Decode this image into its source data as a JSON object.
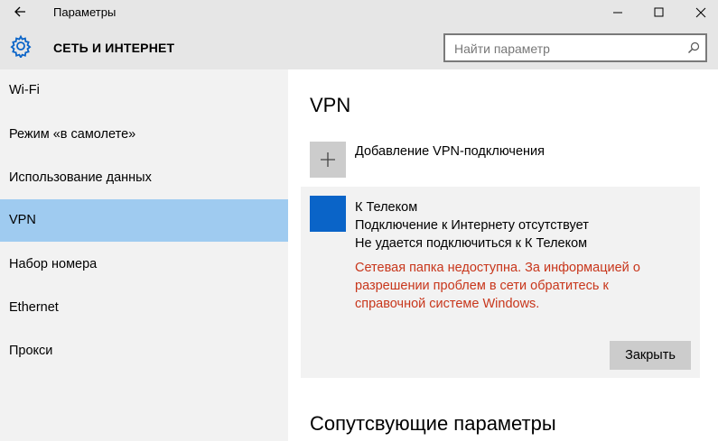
{
  "window": {
    "title": "Параметры",
    "controls": [
      "minimize-icon",
      "maximize-icon",
      "close-icon"
    ]
  },
  "header": {
    "icon": "gear-icon",
    "section_title": "СЕТЬ И ИНТЕРНЕТ",
    "search_placeholder": "Найти параметр"
  },
  "sidebar": {
    "items": [
      {
        "label": "Wi-Fi",
        "active": false
      },
      {
        "label": "Режим «в самолете»",
        "active": false
      },
      {
        "label": "Использование данных",
        "active": false
      },
      {
        "label": "VPN",
        "active": true
      },
      {
        "label": "Набор номера",
        "active": false
      },
      {
        "label": "Ethernet",
        "active": false
      },
      {
        "label": "Прокси",
        "active": false
      }
    ]
  },
  "main": {
    "title": "VPN",
    "add_connection_label": "Добавление VPN-подключения",
    "connection": {
      "name": "К Телеком",
      "status": "Подключение к Интернету отсутствует",
      "detail": "Не удается подключиться к К Телеком",
      "error": "Сетевая папка недоступна. За информацией о разрешении проблем в сети обратитесь к справочной системе Windows.",
      "close_button": "Закрыть"
    },
    "related_title": "Сопутсвующие параметры"
  },
  "colors": {
    "accent": "#0a64c8",
    "selected_nav": "#9fcbf0",
    "error_text": "#c8361b",
    "chrome": "#e6e6e6"
  }
}
